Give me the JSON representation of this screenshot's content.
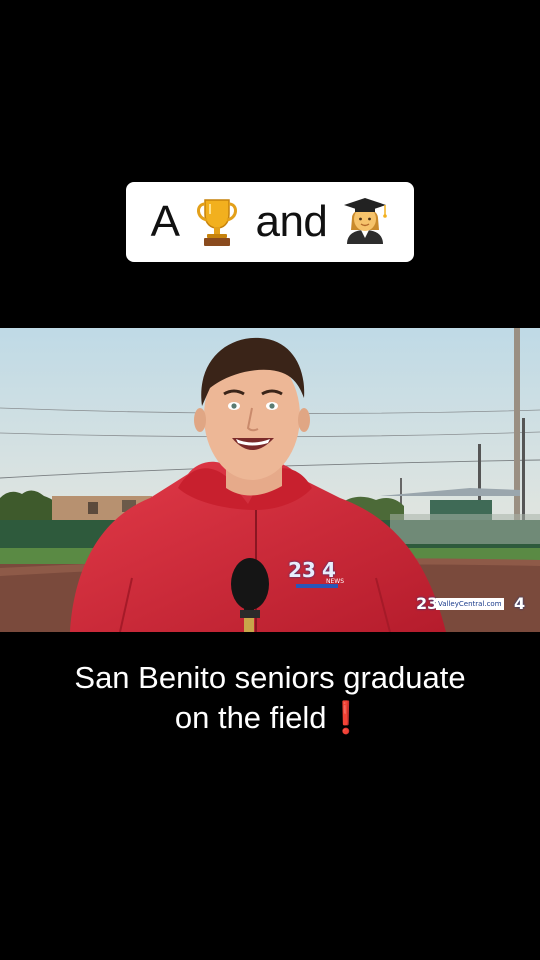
{
  "title_card": {
    "word_left": "A",
    "left_icon": "trophy-icon",
    "word_middle": "and",
    "right_icon": "graduate-icon"
  },
  "video": {
    "jacket_logo_number": "23",
    "jacket_logo_channel": "4",
    "jacket_logo_sub": "NEWS",
    "watermark_number": "23",
    "watermark_site": "ValleyCentral.com",
    "watermark_channel": "4"
  },
  "caption": {
    "line1": "San Benito seniors graduate",
    "line2": "on the field",
    "emoji": "❗"
  },
  "colors": {
    "jacket": "#d8243a",
    "sky": "#cfe0e6",
    "turf": "#5c3a30"
  }
}
